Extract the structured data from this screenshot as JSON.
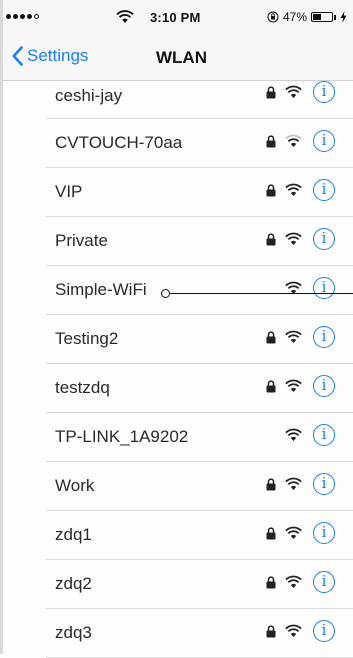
{
  "status_bar": {
    "time": "3:10 PM",
    "battery_percent": "47%",
    "battery_level": 0.47,
    "signal_dots_filled": 4,
    "signal_dots_total": 5,
    "wifi_icon": "wifi-icon",
    "rotation_lock_icon": "rotation-lock-icon",
    "charging_icon": "charging-bolt-icon"
  },
  "nav": {
    "back_label": "Settings",
    "back_icon": "chevron-left-icon",
    "title": "WLAN"
  },
  "colors": {
    "accent": "#1a7ef5",
    "separator": "#dcdcdc",
    "bar_background": "#f7f7f7"
  },
  "networks": [
    {
      "name": "ceshi-jay",
      "locked": true,
      "signal": "full",
      "info_label": "i"
    },
    {
      "name": "CVTOUCH-70aa",
      "locked": true,
      "signal": "weak",
      "info_label": "i"
    },
    {
      "name": "VIP",
      "locked": true,
      "signal": "full",
      "info_label": "i"
    },
    {
      "name": "Private",
      "locked": true,
      "signal": "full",
      "info_label": "i"
    },
    {
      "name": "Simple-WiFi",
      "locked": false,
      "signal": "full",
      "info_label": "i"
    },
    {
      "name": "Testing2",
      "locked": true,
      "signal": "full",
      "info_label": "i"
    },
    {
      "name": "testzdq",
      "locked": true,
      "signal": "full",
      "info_label": "i"
    },
    {
      "name": "TP-LINK_1A9202",
      "locked": false,
      "signal": "full",
      "info_label": "i"
    },
    {
      "name": "Work",
      "locked": true,
      "signal": "full",
      "info_label": "i"
    },
    {
      "name": "zdq1",
      "locked": true,
      "signal": "full",
      "info_label": "i"
    },
    {
      "name": "zdq2",
      "locked": true,
      "signal": "full",
      "info_label": "i"
    },
    {
      "name": "zdq3",
      "locked": true,
      "signal": "full",
      "info_label": "i"
    }
  ]
}
